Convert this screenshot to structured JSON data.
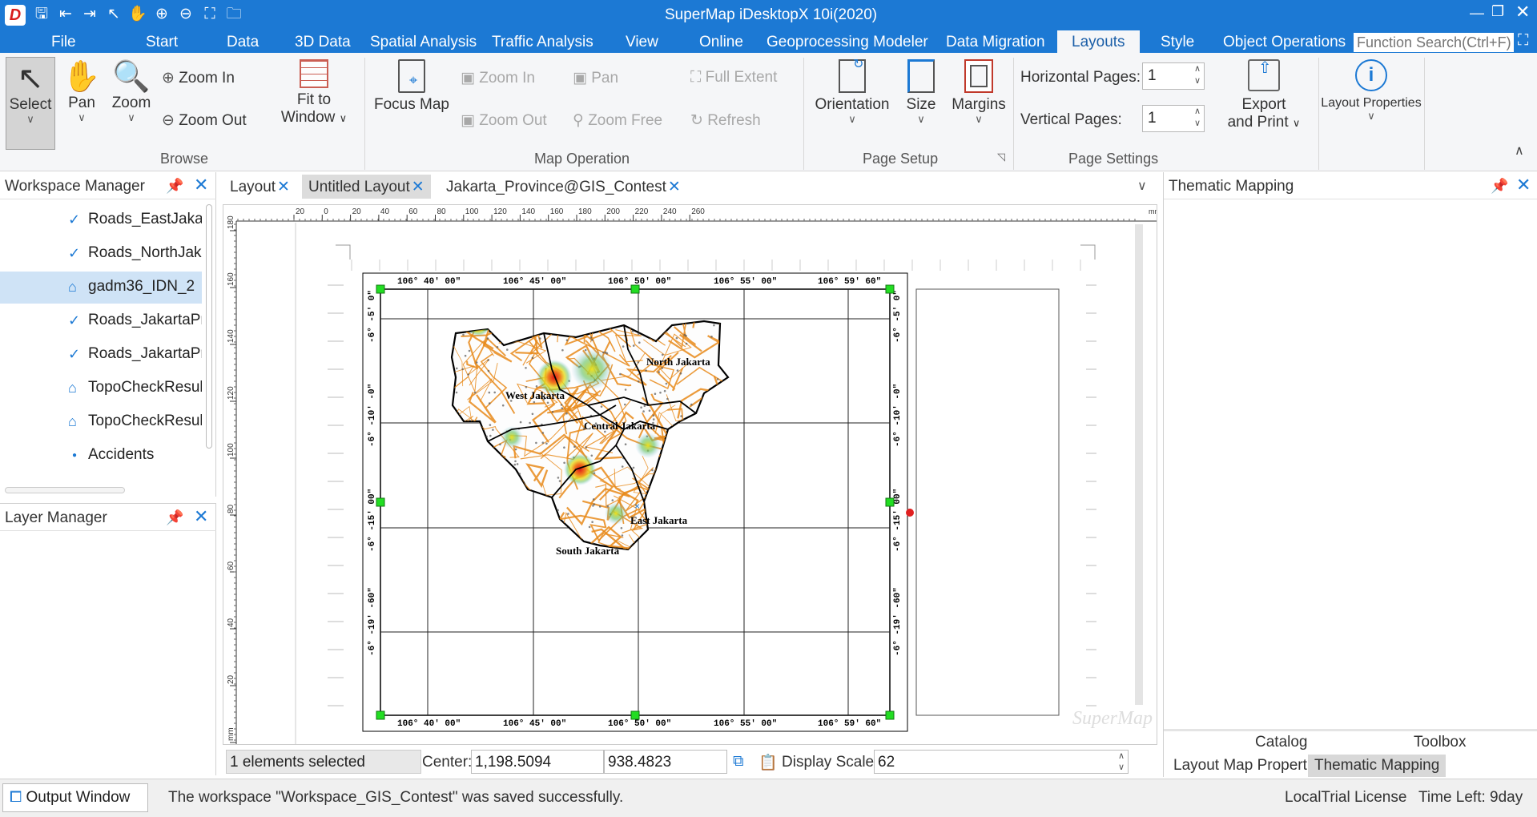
{
  "window": {
    "title": "SuperMap iDesktopX 10i(2020)"
  },
  "menu": {
    "file": "File",
    "start": "Start",
    "data": "Data",
    "d3": "3D Data",
    "spatial": "Spatial Analysis",
    "traffic": "Traffic Analysis",
    "view": "View",
    "online": "Online",
    "geoprocessing": "Geoprocessing Modeler",
    "migration": "Data Migration",
    "layouts": "Layouts",
    "style": "Style",
    "objops": "Object Operations",
    "search_placeholder": "Function Search(Ctrl+F)"
  },
  "ribbon": {
    "browse": {
      "group": "Browse",
      "select": "Select",
      "pan": "Pan",
      "zoom": "Zoom",
      "zoom_in": "Zoom In",
      "zoom_out": "Zoom Out",
      "fit_line1": "Fit to",
      "fit_line2": "Window"
    },
    "mapop": {
      "group": "Map Operation",
      "focus_map": "Focus Map",
      "zoom_in": "Zoom In",
      "zoom_out": "Zoom Out",
      "pan": "Pan",
      "zoom_free": "Zoom Free",
      "full_extent": "Full Extent",
      "refresh": "Refresh"
    },
    "pagesetup": {
      "group": "Page Setup",
      "orientation": "Orientation",
      "size": "Size",
      "margins": "Margins"
    },
    "pagesettings": {
      "group": "Page Settings",
      "horizontal_label": "Horizontal Pages:",
      "horizontal_value": "1",
      "vertical_label": "Vertical Pages:",
      "vertical_value": "1",
      "export_line1": "Export",
      "export_line2": "and Print"
    },
    "layout_properties": "Layout Properties"
  },
  "workspace_manager": {
    "title": "Workspace Manager",
    "items": [
      {
        "label": "Roads_EastJakart",
        "icon": "line-layer-icon"
      },
      {
        "label": "Roads_NorthJaka",
        "icon": "line-layer-icon"
      },
      {
        "label": "gadm36_IDN_2",
        "icon": "region-layer-icon"
      },
      {
        "label": "Roads_JakartaPro",
        "icon": "line-layer-icon"
      },
      {
        "label": "Roads_JakartaPro",
        "icon": "line-layer-icon"
      },
      {
        "label": "TopoCheckResult",
        "icon": "region-layer-icon"
      },
      {
        "label": "TopoCheckResult",
        "icon": "region-layer-icon"
      },
      {
        "label": "Accidents",
        "icon": "point-layer-icon"
      }
    ]
  },
  "layer_manager": {
    "title": "Layer Manager"
  },
  "tabs": [
    {
      "label": "Layout"
    },
    {
      "label": "Untitled Layout"
    },
    {
      "label": "Jakarta_Province@GIS_Contest"
    }
  ],
  "ruler": {
    "top_ticks": [
      "20",
      "0",
      "20",
      "40",
      "60",
      "80",
      "100",
      "120",
      "140",
      "160",
      "180",
      "200",
      "220",
      "240",
      "260"
    ],
    "left_ticks": [
      "180",
      "160",
      "140",
      "120",
      "100",
      "80",
      "60",
      "40",
      "20",
      "mm"
    ],
    "unit": "mm"
  },
  "map": {
    "lon_labels": [
      "106° 40′ 00″",
      "106° 45′ 00″",
      "106° 50′ 00″",
      "106° 55′ 00″",
      "106° 59′ 60″"
    ],
    "lat_labels": [
      "-6° -5′ 0″",
      "-6° -10′ -0″",
      "-6° -15′ 00″",
      "-6° -19′ -60″"
    ],
    "regions": [
      "North Jakarta",
      "West Jakarta",
      "Central Jakarta",
      "East Jakarta",
      "South Jakarta"
    ]
  },
  "thematic_panel": {
    "title": "Thematic Mapping",
    "tabs_top": [
      "Catalog",
      "Toolbox"
    ],
    "tabs_bottom": [
      "Layout Map Properties",
      "Thematic Mapping"
    ]
  },
  "status": {
    "selection": "1 elements selected",
    "center_label": "Center:",
    "center_x": "1,198.5094",
    "center_y": "938.4823",
    "scale_label": "Display Scale:",
    "scale_value": "62",
    "output_window": "Output Window",
    "message": "The workspace \"Workspace_GIS_Contest\" was saved successfully.",
    "license": "LocalTrial License",
    "time_left": "Time Left: 9day"
  },
  "colors": {
    "accent": "#1c79d4",
    "roads": "#e88a1a",
    "heat_hot": "#e01818",
    "heat_mid": "#f0e020"
  }
}
